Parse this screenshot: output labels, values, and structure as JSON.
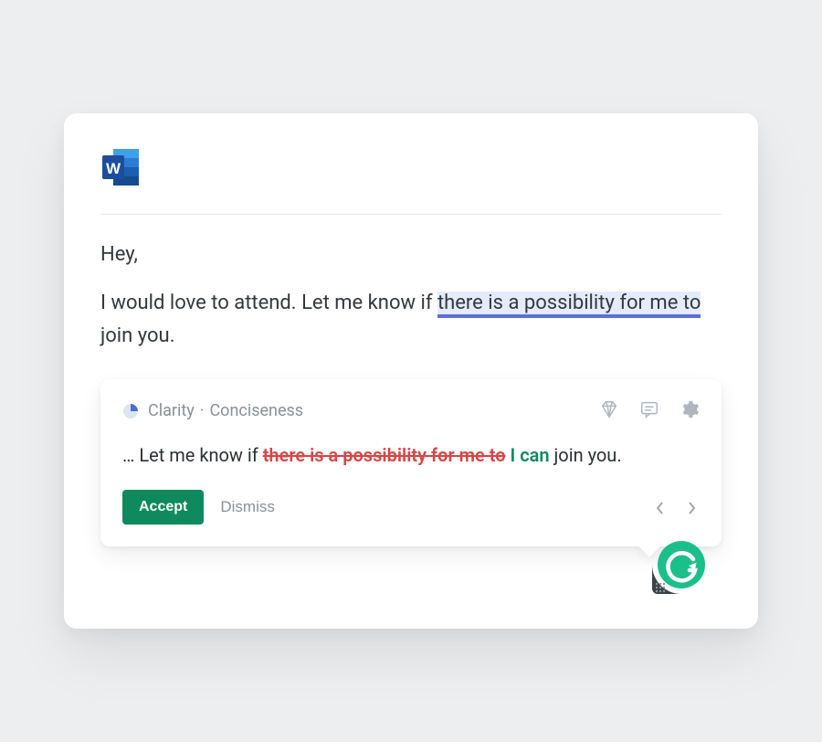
{
  "app": {
    "icon_name": "ms-word-icon"
  },
  "document": {
    "greeting": "Hey,",
    "sentence_prefix": "I would love to attend. Let me know if ",
    "highlighted_phrase": "there is a possibility for me to",
    "sentence_suffix": " join you."
  },
  "suggestion": {
    "category": "Clarity",
    "separator": "·",
    "subcategory": "Conciseness",
    "toolbar_icons": [
      "diamond-icon",
      "comment-icon",
      "gear-icon"
    ],
    "text_prefix": "… Let me know if ",
    "strike_text": "there is a possibility for me to",
    "replacement_text": " I can",
    "text_suffix": " join you.",
    "accept_label": "Accept",
    "dismiss_label": "Dismiss",
    "nav": {
      "prev": "‹",
      "next": "›"
    }
  },
  "assistant_badge": {
    "name": "grammarly-icon",
    "colors": {
      "ring": "#3d4146",
      "fill": "#1bbf8a",
      "letter": "#ffffff"
    }
  }
}
